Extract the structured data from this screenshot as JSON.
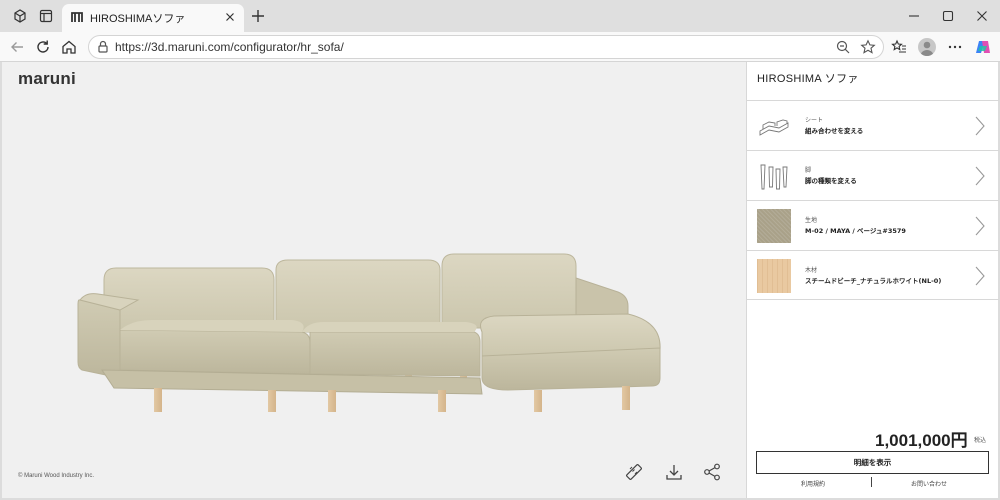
{
  "browser": {
    "tab_title": "HIROSHIMAソファ",
    "url": "https://3d.maruni.com/configurator/hr_sofa/"
  },
  "brand": {
    "logo": "maruni"
  },
  "stage": {
    "copyright": "© Maruni Wood Industry Inc.",
    "tools": [
      "ruler-icon",
      "download-icon",
      "share-icon"
    ]
  },
  "panel": {
    "title": "HIROSHIMA ソファ",
    "options": [
      {
        "category": "シート",
        "value": "組み合わせを変える"
      },
      {
        "category": "脚",
        "value": "脚の種類を変える"
      },
      {
        "category": "生地",
        "value": "M-02 / MAYA / ベージュ#3579"
      },
      {
        "category": "木材",
        "value": "スチームドビーチ_ナチュラルホワイト(NL-0)"
      }
    ],
    "price": "1,001,000円",
    "tax_label": "税込",
    "detail_button": "明細を表示",
    "footer_links": [
      "利用規約",
      "お問い合わせ"
    ]
  },
  "colors": {
    "fabric": "#d2cdb6",
    "wood": "#e6c9a1",
    "stage_bg": "#f0f0f0"
  }
}
